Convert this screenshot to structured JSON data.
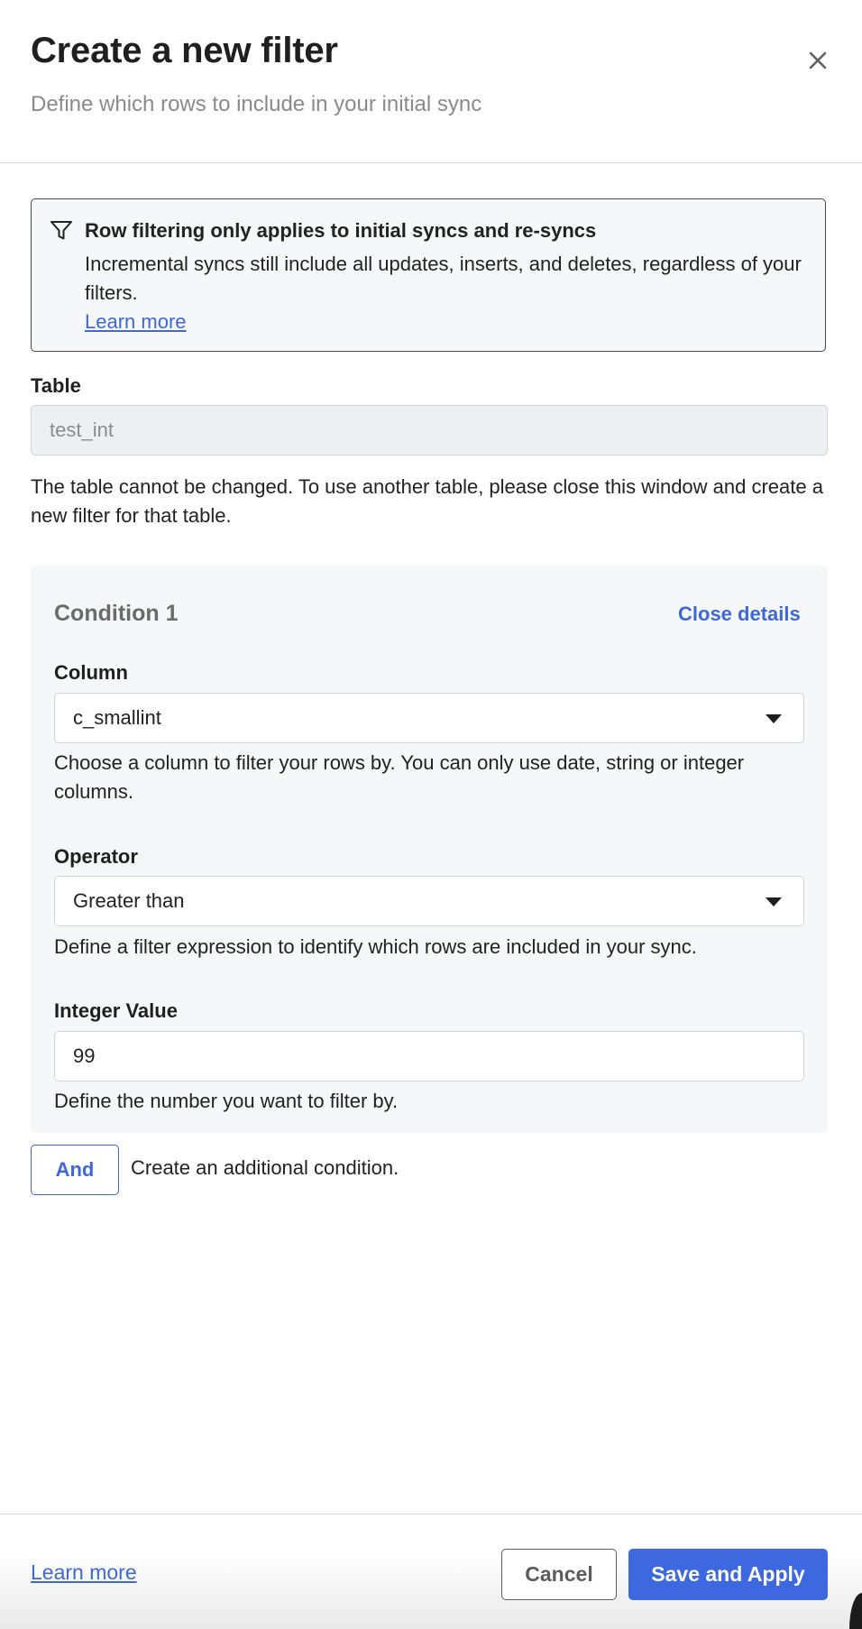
{
  "header": {
    "title": "Create a new filter",
    "subtitle": "Define which rows to include in your initial sync",
    "close_icon": "close-icon"
  },
  "notice": {
    "icon": "filter-icon",
    "title": "Row filtering only applies to initial syncs and re-syncs",
    "body": "Incremental syncs still include all updates, inserts, and deletes, regardless of your filters.",
    "link": "Learn more"
  },
  "table": {
    "label": "Table",
    "value": "test_int",
    "help": "The table cannot be changed. To use another table, please close this window and create a new filter for that table."
  },
  "condition": {
    "title": "Condition 1",
    "close_details": "Close details",
    "column": {
      "label": "Column",
      "value": "c_smallint",
      "help": "Choose a column to filter your rows by. You can only use date, string or integer columns."
    },
    "operator": {
      "label": "Operator",
      "value": "Greater than",
      "help": "Define a filter expression to identify which rows are included in your sync."
    },
    "integer_value": {
      "label": "Integer Value",
      "value": "99",
      "help": "Define the number you want to filter by."
    }
  },
  "and_button": {
    "label": "And",
    "help": "Create an additional condition."
  },
  "footer": {
    "learn_more": "Learn more",
    "cancel": "Cancel",
    "save": "Save and Apply"
  },
  "colors": {
    "accent": "#3e68e0",
    "link": "#3e68d8",
    "panel_bg": "#f6f7f9",
    "disabled_bg": "#eeeff2"
  }
}
